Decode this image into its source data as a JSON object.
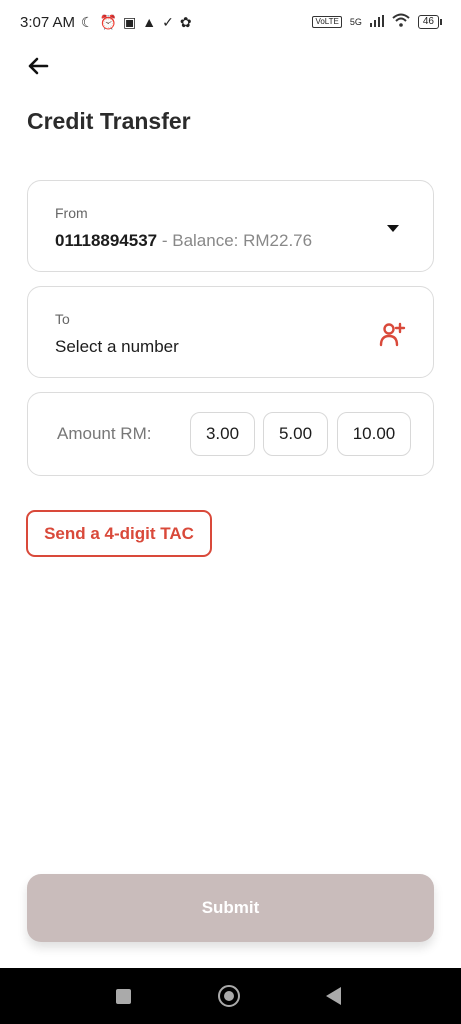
{
  "status_bar": {
    "time": "3:07 AM",
    "icons_left": [
      "moon-icon",
      "alarm-icon",
      "nfc-icon",
      "upload-icon",
      "check-icon",
      "settings-icon"
    ],
    "volte": "VoLTE",
    "network": "5G",
    "battery": "46"
  },
  "header": {
    "title": "Credit Transfer"
  },
  "from": {
    "label": "From",
    "number": "01118894537",
    "balance_text": " - Balance:  RM22.76"
  },
  "to": {
    "label": "To",
    "placeholder": "Select a number"
  },
  "amount": {
    "label": "Amount RM:",
    "options": [
      "3.00",
      "5.00",
      "10.00"
    ]
  },
  "tac_button": "Send a 4-digit TAC",
  "submit_button": "Submit",
  "colors": {
    "accent": "#d9493a",
    "submit_disabled": "#c9bcbb",
    "nav_bar": "#000000"
  }
}
